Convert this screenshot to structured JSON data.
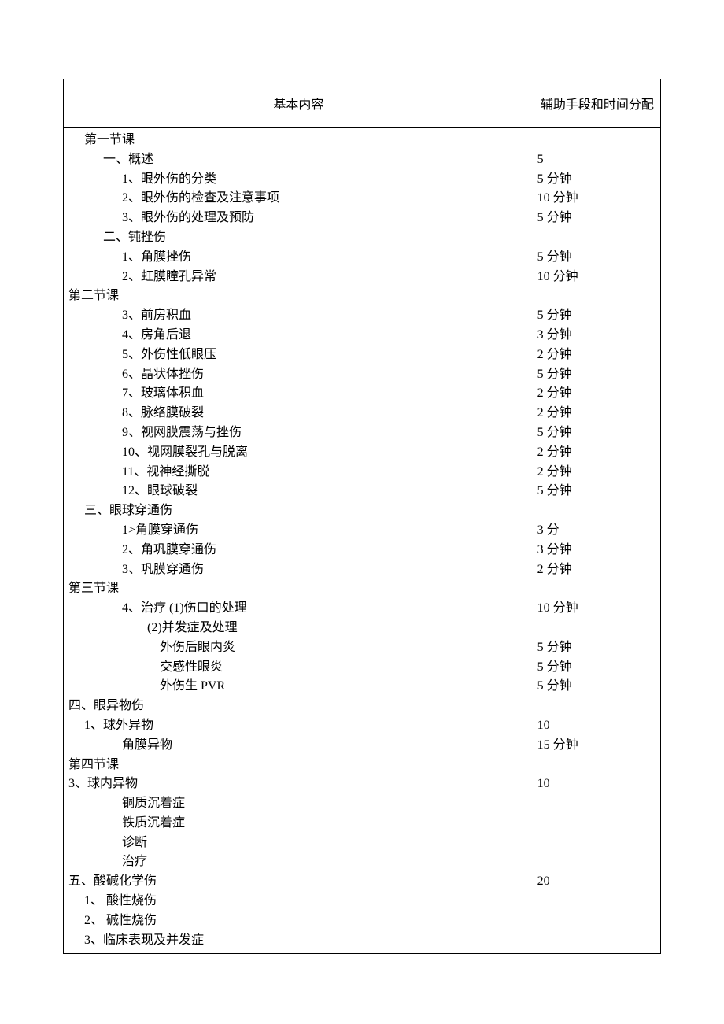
{
  "header": {
    "col_left": "基本内容",
    "col_right": "辅助手段和时间分配"
  },
  "rows": [
    {
      "indent": 1,
      "text": "第一节课",
      "time": ""
    },
    {
      "indent": 2,
      "text": "一、概述",
      "time": "5"
    },
    {
      "indent": 3,
      "text": "1、眼外伤的分类",
      "time": "5 分钟"
    },
    {
      "indent": 3,
      "text": "2、眼外伤的检查及注意事项",
      "time": "10 分钟"
    },
    {
      "indent": 3,
      "text": "3、眼外伤的处理及预防",
      "time": "5 分钟"
    },
    {
      "indent": 2,
      "text": "二、钝挫伤",
      "time": ""
    },
    {
      "indent": 3,
      "text": "1、角膜挫伤",
      "time": "5 分钟"
    },
    {
      "indent": 3,
      "text": "2、虹膜瞳孔异常",
      "time": "10 分钟"
    },
    {
      "indent": 0,
      "text": "第二节课",
      "time": ""
    },
    {
      "indent": 3,
      "text": "3、前房积血",
      "time": "5 分钟"
    },
    {
      "indent": 3,
      "text": "4、房角后退",
      "time": "3 分钟"
    },
    {
      "indent": 3,
      "text": "5、外伤性低眼压",
      "time": "2 分钟"
    },
    {
      "indent": 3,
      "text": "6、晶状体挫伤",
      "time": "5 分钟"
    },
    {
      "indent": 3,
      "text": "7、玻璃体积血",
      "time": "2 分钟"
    },
    {
      "indent": 3,
      "text": "8、脉络膜破裂",
      "time": "2 分钟"
    },
    {
      "indent": 3,
      "text": "9、视网膜震荡与挫伤",
      "time": "5 分钟"
    },
    {
      "indent": 3,
      "text": "10、视网膜裂孔与脱离",
      "time": "2 分钟"
    },
    {
      "indent": 3,
      "text": "11、视神经撕脱",
      "time": "2 分钟"
    },
    {
      "indent": 3,
      "text": "12、眼球破裂",
      "time": "5 分钟"
    },
    {
      "indent": 1,
      "text": "三、眼球穿通伤",
      "time": ""
    },
    {
      "indent": 3,
      "text": "1>角膜穿通伤",
      "time": "3 分"
    },
    {
      "indent": 3,
      "text": "2、角巩膜穿通伤",
      "time": "3 分钟"
    },
    {
      "indent": 3,
      "text": "3、巩膜穿通伤",
      "time": "2 分钟"
    },
    {
      "indent": 0,
      "text": "第三节课",
      "time": ""
    },
    {
      "indent": 3,
      "text": "4、治疗 (1)伤口的处理",
      "time": "10 分钟"
    },
    {
      "indent": 4,
      "text": "  (2)并发症及处理",
      "time": ""
    },
    {
      "indent": 5,
      "text": "外伤后眼内炎",
      "time": "5 分钟"
    },
    {
      "indent": 5,
      "text": "交感性眼炎",
      "time": "5 分钟"
    },
    {
      "indent": 5,
      "text": "外伤生 PVR",
      "time": "5 分钟"
    },
    {
      "indent": 0,
      "text": "四、眼异物伤",
      "time": ""
    },
    {
      "indent": 1,
      "text": "1、球外异物",
      "time": "10"
    },
    {
      "indent": 3,
      "text": "角膜异物",
      "time": "15 分钟"
    },
    {
      "indent": 0,
      "text": "第四节课",
      "time": ""
    },
    {
      "indent": 0,
      "text": "3、球内异物",
      "time": "10"
    },
    {
      "indent": 3,
      "text": "铜质沉着症",
      "time": ""
    },
    {
      "indent": 3,
      "text": "铁质沉着症",
      "time": ""
    },
    {
      "indent": 3,
      "text": "诊断",
      "time": ""
    },
    {
      "indent": 3,
      "text": "治疗",
      "time": ""
    },
    {
      "indent": 0,
      "text": "五、酸碱化学伤",
      "time": "20"
    },
    {
      "indent": 1,
      "text": "1、 酸性烧伤",
      "time": ""
    },
    {
      "indent": 1,
      "text": "2、 碱性烧伤",
      "time": ""
    },
    {
      "indent": 1,
      "text": "3、临床表现及并发症",
      "time": ""
    }
  ]
}
